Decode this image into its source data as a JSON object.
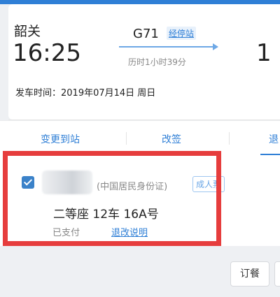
{
  "ticket": {
    "from_station": "韶关",
    "departure_time": "16:25",
    "arrival_time_partial": "1",
    "train_number": "G71",
    "via_stations_link": "经停站",
    "duration": "历时1小时39分",
    "departure_date": "发车时间：2019年07月14日 周日"
  },
  "actions": {
    "change_destination": "变更到站",
    "reschedule": "改签",
    "refund_partial": "退"
  },
  "passenger": {
    "id_type": "(中国居民身份证)",
    "ticket_type_badge": "成人票",
    "seat_info": "二等座 12车 16A号",
    "status": "已支付",
    "refund_rules_link": "退改说明"
  },
  "bottom": {
    "meal_button": "订餐"
  },
  "colors": {
    "accent": "#2f7fd6",
    "highlight_border": "#e63d3d"
  }
}
